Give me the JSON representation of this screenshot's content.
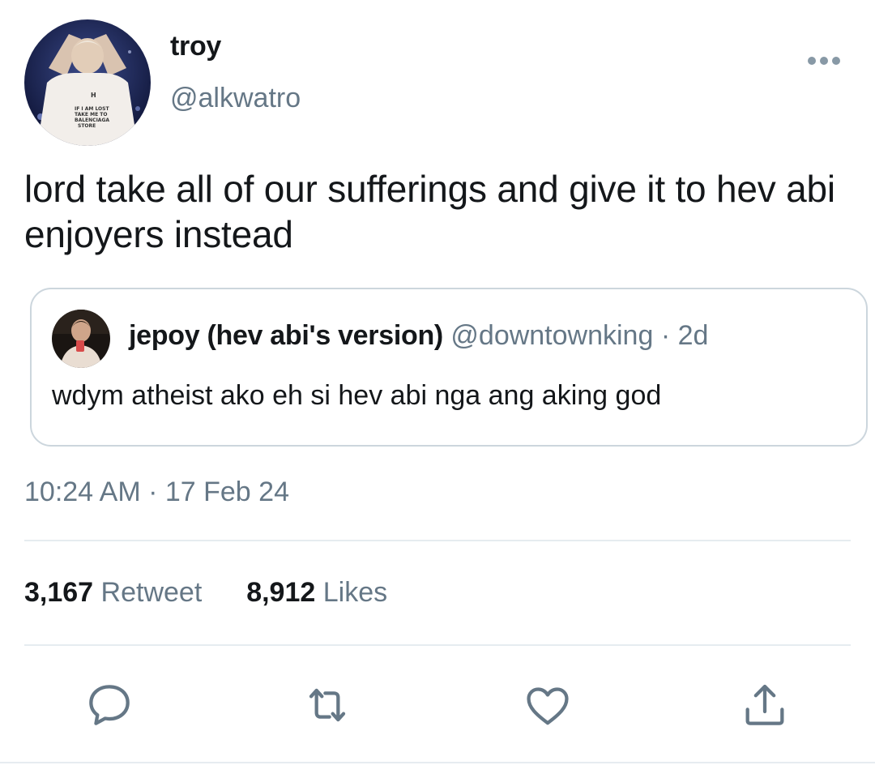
{
  "author": {
    "display_name": "troy",
    "handle": "@alkwatro",
    "avatar_shirt_text": [
      "IF I AM LOST",
      "TAKE ME TO",
      "BALENCIAGA",
      "STORE"
    ]
  },
  "tweet": {
    "text": "lord take all of our sufferings and give it to hev abi enjoyers instead",
    "timestamp": "10:24 AM · 17 Feb 24"
  },
  "quoted_tweet": {
    "display_name": "jepoy (hev abi's version)",
    "handle": "@downtownking",
    "separator": "·",
    "age": "2d",
    "text": "wdym atheist ako eh si hev abi nga ang aking god"
  },
  "stats": {
    "retweets_count": "3,167",
    "retweets_label": "Retweet",
    "likes_count": "8,912",
    "likes_label": "Likes"
  },
  "actions": [
    "reply-icon",
    "retweet-icon",
    "like-icon",
    "share-icon"
  ],
  "colors": {
    "text": "#14171a",
    "secondary": "#657786",
    "border": "#ccd6dd",
    "divider": "#e6ecf0"
  }
}
